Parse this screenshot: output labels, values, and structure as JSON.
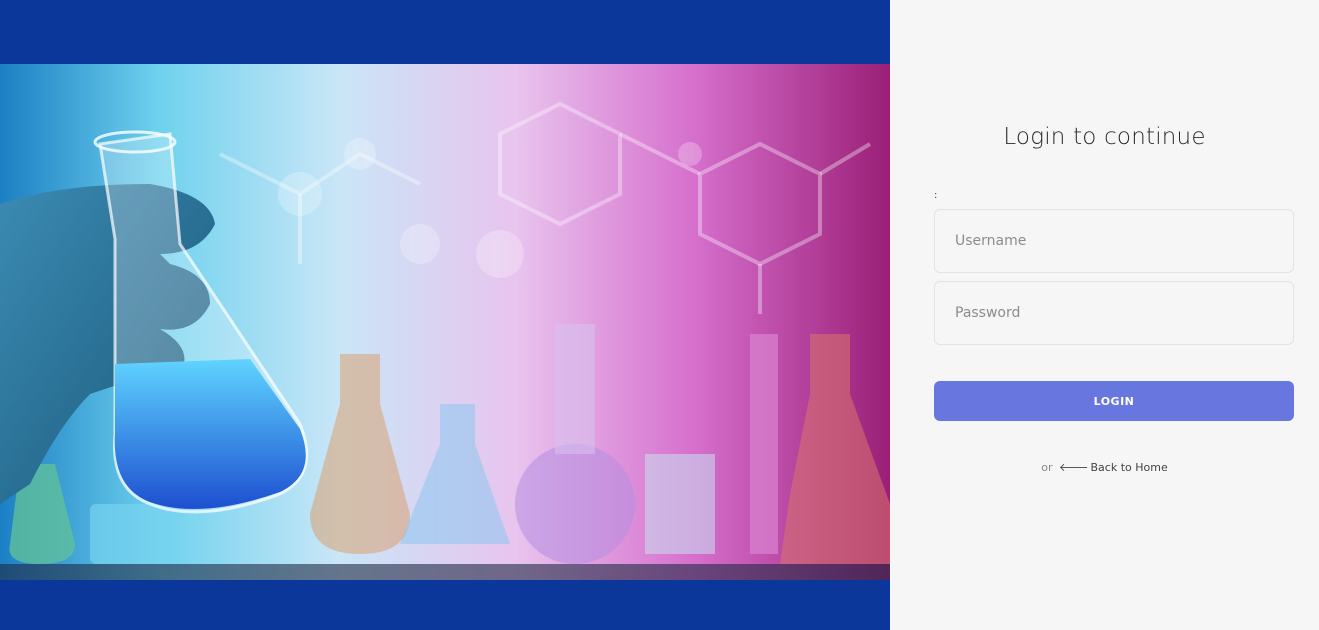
{
  "login": {
    "title": "Login to continue",
    "colon": ":",
    "username_placeholder": "Username",
    "username_value": "",
    "password_placeholder": "Password",
    "password_value": "",
    "submit_label": "LOGIN",
    "or_text": "or",
    "back_icon": "arrow-left-icon",
    "back_label": "Back to Home"
  },
  "colors": {
    "brand_blue": "#0a3799",
    "button": "#6877e0",
    "panel_bg": "#f6f6f6"
  },
  "hero": {
    "description_icon": "laboratory-flasks-image"
  }
}
